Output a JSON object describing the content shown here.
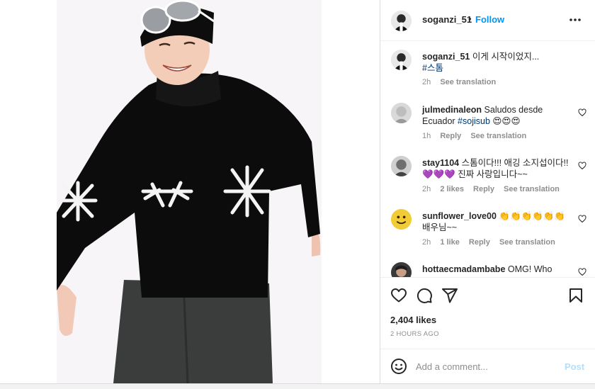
{
  "header": {
    "username": "soganzi_51",
    "separator": "•",
    "follow_label": "Follow"
  },
  "caption": {
    "username": "soganzi_51",
    "text": "이게 시작이었지...",
    "hashtag": "#스톰",
    "time": "2h",
    "see_translation": "See translation"
  },
  "comments": [
    {
      "username": "julmedinaleon",
      "text": "Saludos desde Ecuador",
      "hashtag": "#sojisub",
      "emoji": "😍😍😍",
      "time": "1h",
      "likes": "",
      "reply": "Reply",
      "see_translation": "See translation"
    },
    {
      "username": "stay1104",
      "text": "스톰이다!!! 애깅 소지섭이다!!",
      "emoji": "💜💜💜",
      "text2": "진짜 사랑입니다~~",
      "time": "2h",
      "likes": "2 likes",
      "reply": "Reply",
      "see_translation": "See translation"
    },
    {
      "username": "sunflower_love00",
      "emoji": "👏👏👏👏👏👏",
      "text": "배우님~~",
      "time": "2h",
      "likes": "1 like",
      "reply": "Reply",
      "see_translation": "See translation"
    },
    {
      "username": "hottaecmadambabe",
      "text": "OMG! Who"
    }
  ],
  "post_stats": {
    "likes": "2,404 likes",
    "timestamp": "2 HOURS AGO"
  },
  "add_comment": {
    "placeholder": "Add a comment...",
    "post_label": "Post"
  },
  "icons": {
    "like": "heart-icon",
    "comment": "comment-icon",
    "share": "paper-plane-icon",
    "save": "bookmark-icon",
    "more": "more-options-icon",
    "emoji": "emoji-icon"
  },
  "colors": {
    "accent": "#0095f6",
    "post_disabled": "#b2dffc",
    "hashtag": "#00376b",
    "muted": "#8e8e8e"
  }
}
